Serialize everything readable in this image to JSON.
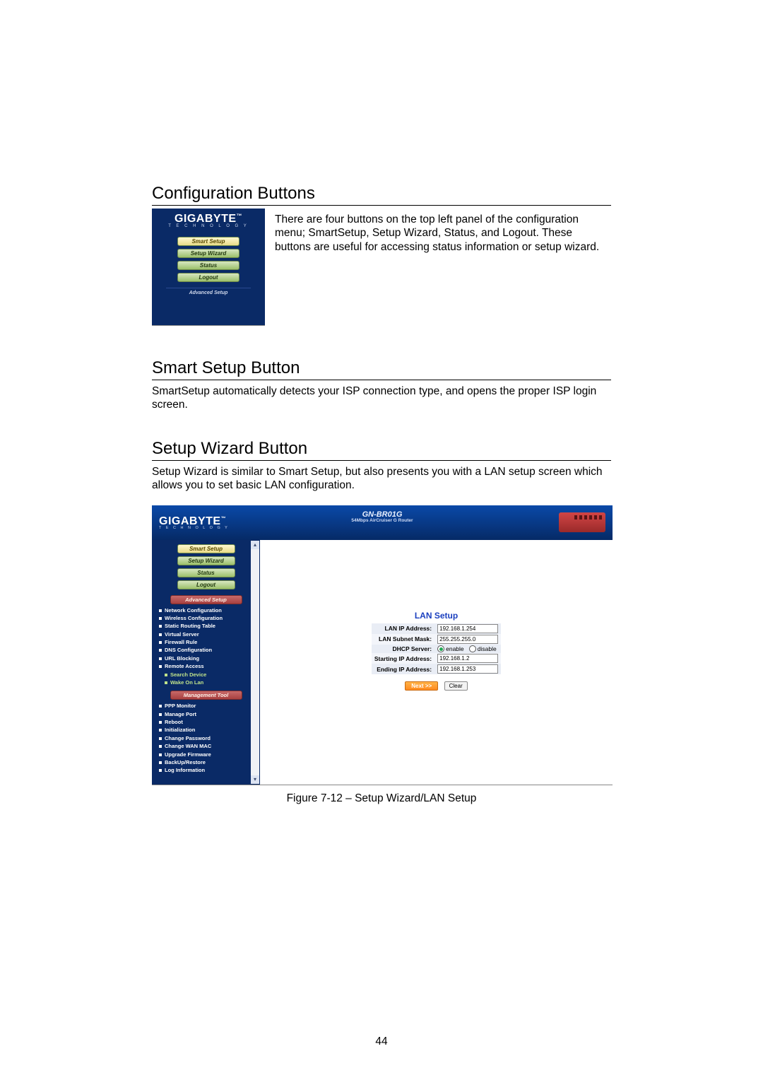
{
  "sections": {
    "config_buttons": {
      "heading": "Configuration Buttons",
      "paragraph": "There are four buttons on the top left panel of the configuration menu; SmartSetup, Setup Wizard, Status, and Logout. These buttons are useful for accessing status information or setup wizard."
    },
    "smart_setup": {
      "heading": "Smart Setup Button",
      "paragraph": "SmartSetup automatically detects your ISP connection type, and opens the proper ISP login screen."
    },
    "setup_wizard": {
      "heading": "Setup Wizard Button",
      "paragraph": "Setup Wizard is similar to Smart Setup, but also presents you with a LAN setup screen which allows you to set basic LAN configuration."
    }
  },
  "thumb_panel": {
    "brand": "GIGABYTE",
    "brand_sub": "T E C H N O L O G Y",
    "buttons": [
      "Smart Setup",
      "Setup Wizard",
      "Status",
      "Logout"
    ],
    "advanced": "Advanced Setup"
  },
  "figure": {
    "brand": "GIGABYTE",
    "brand_sub": "T E C H N O L O G Y",
    "model": "GN-BR01G",
    "model_sub": "54Mbps AirCruiser G Router",
    "sidebar": {
      "top_buttons": [
        "Smart Setup",
        "Setup Wizard",
        "Status",
        "Logout"
      ],
      "advanced_label": "Advanced Setup",
      "advanced_items": [
        "Network Configuration",
        "Wireless Configuration",
        "Static Routing Table",
        "Virtual Server",
        "Firewall Rule",
        "DNS Configuration",
        "URL Blocking",
        "Remote Access"
      ],
      "advanced_sub": [
        "Search Device",
        "Wake On Lan"
      ],
      "mgmt_label": "Management Tool",
      "mgmt_items": [
        "PPP Monitor",
        "Manage Port",
        "Reboot",
        "Initialization",
        "Change Password",
        "Change WAN MAC",
        "Upgrade Firmware",
        "BackUp/Restore",
        "Log Information"
      ]
    },
    "lan": {
      "title": "LAN Setup",
      "rows": {
        "ip_label": "LAN IP Address:",
        "ip_value": "192.168.1.254",
        "mask_label": "LAN Subnet Mask:",
        "mask_value": "255.255.255.0",
        "dhcp_label": "DHCP Server:",
        "dhcp_enable": "enable",
        "dhcp_disable": "disable",
        "start_label": "Starting IP Address:",
        "start_value": "192.168.1.2",
        "end_label": "Ending IP Address:",
        "end_value": "192.168.1.253"
      },
      "next": "Next >>",
      "clear": "Clear"
    },
    "caption": "Figure 7-12 – Setup Wizard/LAN Setup"
  },
  "page_number": "44"
}
